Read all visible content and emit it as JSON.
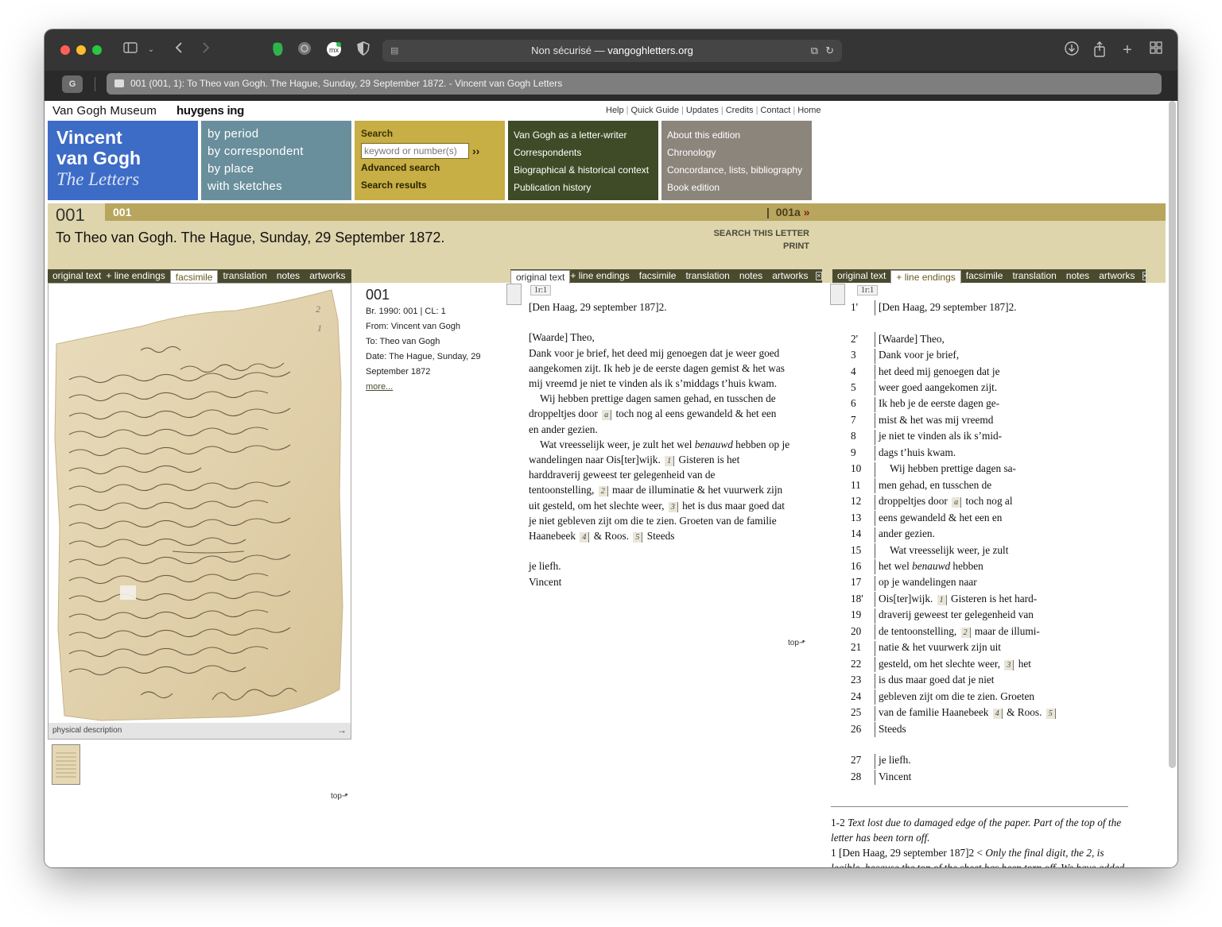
{
  "browser": {
    "address": "Non sécurisé — vangoghletters.org",
    "address_prefix": "Non sécurisé — ",
    "address_domain": "vangoghletters.org",
    "tab_title": "001 (001, 1): To Theo van Gogh. The Hague, Sunday, 29 September 1872. - Vincent van Gogh Letters",
    "tab_g": "G"
  },
  "site": {
    "museum": "Van Gogh Museum",
    "huygens": "huygens ing",
    "toplinks": [
      "Help",
      "Quick Guide",
      "Updates",
      "Credits",
      "Contact",
      "Home"
    ],
    "title_line1": "Vincent",
    "title_line2": "van Gogh",
    "title_line3": "The Letters",
    "browse": [
      "by period",
      "by correspondent",
      "by place",
      "with sketches"
    ],
    "search_label": "Search",
    "search_placeholder": "keyword or number(s)",
    "search_go": "››",
    "advanced_search": "Advanced search",
    "search_results": "Search results",
    "context": [
      "Van Gogh as a letter-writer",
      "Correspondents",
      "Biographical & historical context",
      "Publication history"
    ],
    "about": [
      "About this edition",
      "Chronology",
      "Concordance, lists, bibliography",
      "Book edition"
    ]
  },
  "letter": {
    "number_big": "001",
    "number_small": "001",
    "next_number": "001a",
    "next_arrow": "»",
    "next_sep": "|",
    "title": "To Theo van Gogh. The Hague, Sunday, 29 September 1872.",
    "search_this": "SEARCH THIS LETTER",
    "print": "PRINT"
  },
  "tabs": {
    "left": [
      "original text",
      "+ line endings",
      "facsimile",
      "translation",
      "notes",
      "artworks"
    ],
    "middle": [
      "original text",
      "+ line endings",
      "facsimile",
      "translation",
      "notes",
      "artworks"
    ],
    "right": [
      "original text",
      "+ line endings",
      "facsimile",
      "translation",
      "notes",
      "artworks"
    ],
    "close": "×"
  },
  "facsimile": {
    "physical_description": "physical description",
    "arrow": "→",
    "top": "top"
  },
  "meta": {
    "number": "001",
    "br": "Br. 1990: 001 | CL: 1",
    "from": "From: Vincent van Gogh",
    "to": "To: Theo van Gogh",
    "date_l1": "Date: The Hague, Sunday, 29",
    "date_l2": "September 1872",
    "more": "more..."
  },
  "original": {
    "page_label": "1r:1",
    "top": "top",
    "notes": [
      "a",
      "1",
      "2",
      "3",
      "4",
      "5"
    ],
    "l1": "[Den Haag, 29 september 187]2.",
    "l2": "[Waarde] Theo,",
    "l3": "Dank voor je brief, het deed mij genoegen dat je weer goed",
    "l4": "aangekomen zijt. Ik heb je de eerste dagen gemist & het was",
    "l5": "mij vreemd je niet te vinden als ik s’middags t’huis kwam.",
    "l6": "Wij hebben prettige dagen samen gehad, en tusschen de",
    "l7a": "droppeltjes door",
    "l7b": "toch nog al eens gewandeld & het een",
    "l8": "en ander gezien.",
    "l9a": "Wat vreesselijk weer, je zult het wel ",
    "l9b": "benauwd",
    "l9c": " hebben op je",
    "l10a": "wandelingen naar Ois[ter]wijk.",
    "l10b": "Gisteren is het",
    "l11": "harddraverij geweest ter gelegenheid van de",
    "l12a": "tentoonstelling,",
    "l12b": "maar de illuminatie & het vuurwerk zijn",
    "l13a": "uit gesteld, om het slechte weer,",
    "l13b": "het is dus maar goed dat",
    "l14": "je niet gebleven zijt om die te zien. Groeten van de familie",
    "l15a": "Haanebeek",
    "l15b": "& Roos.",
    "l15c": "Steeds",
    "l16": "je liefh.",
    "l17": "Vincent"
  },
  "line_endings": {
    "page_label": "1r:1",
    "rows": [
      {
        "n": "1'",
        "t": "[Den Haag, 29 september 187]2."
      },
      {
        "n": "",
        "t": ""
      },
      {
        "n": "2'",
        "t": "[Waarde] Theo,"
      },
      {
        "n": "3",
        "t": "Dank voor je brief,"
      },
      {
        "n": "4",
        "t": "het deed mij genoegen dat je"
      },
      {
        "n": "5",
        "t": "weer goed aangekomen zijt."
      },
      {
        "n": "6",
        "t": "Ik heb je de eerste dagen ge-"
      },
      {
        "n": "7",
        "t": "mist & het was mij vreemd"
      },
      {
        "n": "8",
        "t": "je niet te vinden als ik s’mid-"
      },
      {
        "n": "9",
        "t": "dags t’huis kwam."
      },
      {
        "n": "10",
        "t": "Wij hebben prettige dagen sa-",
        "indent": true
      },
      {
        "n": "11",
        "t": "men gehad, en tusschen de"
      },
      {
        "n": "12",
        "t": "droppeltjes door",
        "note": "a",
        "after": "toch nog al"
      },
      {
        "n": "13",
        "t": "eens gewandeld & het een en"
      },
      {
        "n": "14",
        "t": "ander gezien."
      },
      {
        "n": "15",
        "t": "Wat vreesselijk weer, je zult",
        "indent": true
      },
      {
        "n": "16",
        "t": "het wel ",
        "italic": "benauwd",
        "after_plain": " hebben"
      },
      {
        "n": "17",
        "t": "op je wandelingen naar"
      },
      {
        "n": "18'",
        "t": "Ois[ter]wijk.",
        "note": "1",
        "after": "Gisteren is het hard-"
      },
      {
        "n": "19",
        "t": "draverij geweest ter gelegenheid van"
      },
      {
        "n": "20",
        "t": "de tentoonstelling,",
        "note": "2",
        "after": "maar de illumi-"
      },
      {
        "n": "21",
        "t": "natie & het vuurwerk zijn uit"
      },
      {
        "n": "22",
        "t": "gesteld, om het slechte weer,",
        "note": "3",
        "after": "het"
      },
      {
        "n": "23",
        "t": "is dus maar goed dat je niet"
      },
      {
        "n": "24",
        "t": "gebleven zijt om die te zien. Groeten"
      },
      {
        "n": "25",
        "t": "van de familie Haanebeek",
        "note": "4",
        "after": "& Roos.",
        "note2": "5"
      },
      {
        "n": "26",
        "t": "Steeds"
      },
      {
        "n": "",
        "t": ""
      },
      {
        "n": "27",
        "t": "je liefh."
      },
      {
        "n": "28",
        "t": "Vincent"
      }
    ]
  },
  "footnotes": {
    "f1_ref": "1-2",
    "f1_text": "Text lost due to damaged edge of the paper. Part of the top of the letter has been torn off.",
    "f2_ref": "1 [Den Haag, 29 september 187]2 <",
    "f2_text": "Only the final digit, the 2, is legible, because the top of the sheet has been torn off. We have added the place and date on the basis of Van Gogh’s usual way of heading his letters in this period."
  }
}
